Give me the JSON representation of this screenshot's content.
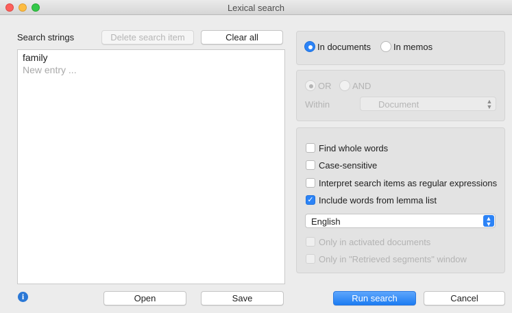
{
  "window": {
    "title": "Lexical search"
  },
  "left": {
    "heading": "Search strings",
    "delete_label": "Delete search item",
    "clear_label": "Clear all",
    "entries": [
      "family"
    ],
    "new_entry_placeholder": "New entry ..."
  },
  "scope": {
    "in_documents": "In documents",
    "in_memos": "In memos",
    "selected": "In documents"
  },
  "logic": {
    "or_label": "OR",
    "and_label": "AND",
    "within_label": "Within",
    "within_value": "Document"
  },
  "options": {
    "find_whole_words": {
      "label": "Find whole words",
      "checked": false
    },
    "case_sensitive": {
      "label": "Case-sensitive",
      "checked": false
    },
    "regex": {
      "label": "Interpret search items as regular expressions",
      "checked": false
    },
    "lemma": {
      "label": "Include words from lemma list",
      "checked": true
    },
    "language": "English",
    "only_activated": {
      "label": "Only in activated documents",
      "enabled": false
    },
    "only_retrieved": {
      "label": "Only in \"Retrieved segments\" window",
      "enabled": false
    }
  },
  "footer": {
    "open_label": "Open",
    "save_label": "Save",
    "run_label": "Run search",
    "cancel_label": "Cancel"
  },
  "icons": {
    "info": "info-icon",
    "select_arrows": "up-down-chevron-icon",
    "checkmark": "checkmark-icon"
  },
  "colors": {
    "accent": "#2c83f6",
    "window_bg": "#ececec",
    "panel_bg": "#e3e3e3",
    "disabled_text": "#b3b3b3"
  }
}
